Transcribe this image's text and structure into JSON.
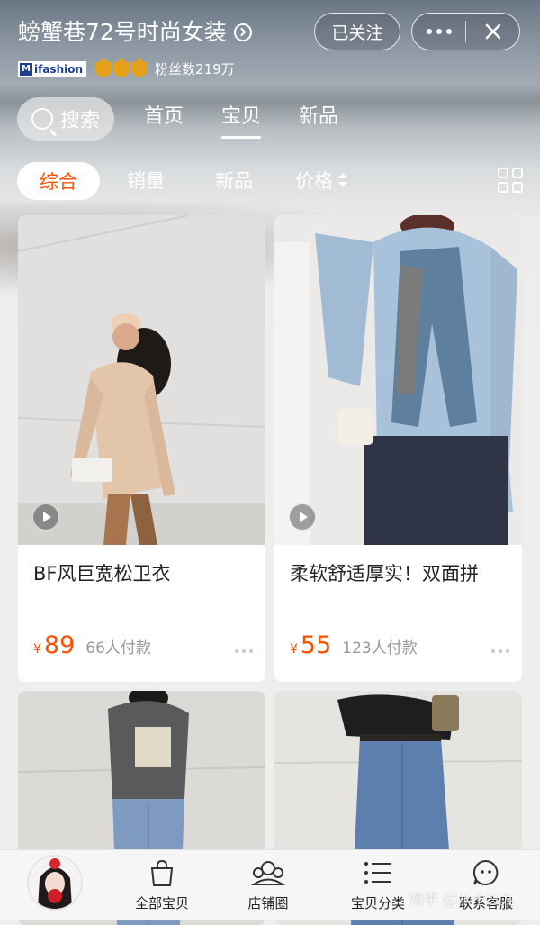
{
  "header": {
    "store_name": "螃蟹巷72号时尚女装",
    "follow_label": "已关注",
    "badge_text": "ifashion",
    "fans_text": "粉丝数219万"
  },
  "nav": {
    "search_label": "搜索",
    "tabs": [
      {
        "label": "首页",
        "active": false
      },
      {
        "label": "宝贝",
        "active": true
      },
      {
        "label": "新品",
        "active": false
      }
    ]
  },
  "sort": {
    "items": [
      "综合",
      "销量",
      "新品",
      "价格"
    ],
    "active": "综合"
  },
  "products": [
    {
      "title": "BF风巨宽松卫衣",
      "currency": "¥",
      "price": "89",
      "paid": "66人付款",
      "has_video": true
    },
    {
      "title": "柔软舒适厚实！双面拼",
      "currency": "¥",
      "price": "55",
      "paid": "123人付款",
      "has_video": true
    },
    {
      "title": "",
      "currency": "",
      "price": "",
      "paid": "",
      "has_video": false
    },
    {
      "title": "",
      "currency": "",
      "price": "",
      "paid": "",
      "has_video": false
    }
  ],
  "bottom_bar": {
    "items": [
      {
        "label": "全部宝贝",
        "icon": "shopping-bag-icon"
      },
      {
        "label": "店铺圈",
        "icon": "community-icon"
      },
      {
        "label": "宝贝分类",
        "icon": "category-list-icon"
      },
      {
        "label": "联系客服",
        "icon": "customer-service-icon"
      }
    ]
  },
  "watermark": "知乎 @八十三九",
  "colors": {
    "accent": "#ff5000",
    "text": "#222222",
    "muted": "#999999"
  }
}
